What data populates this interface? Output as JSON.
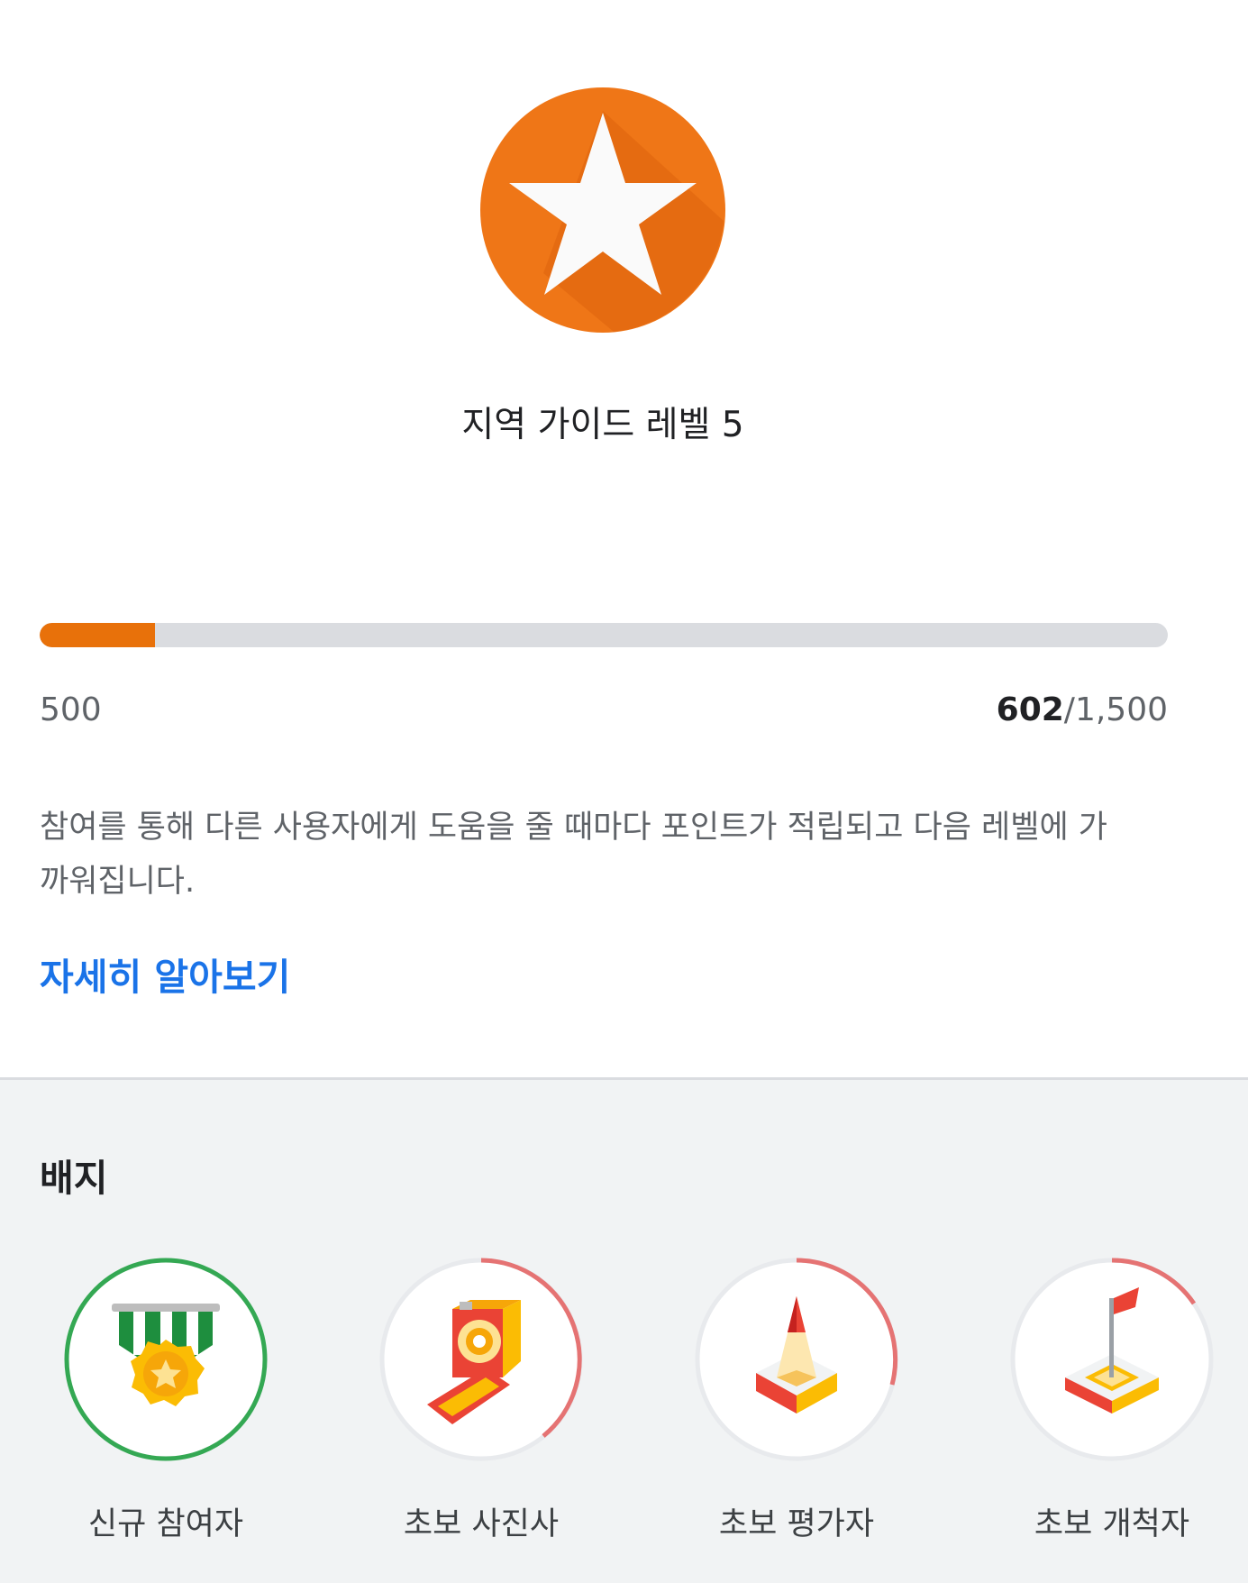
{
  "level": {
    "title": "지역 가이드 레벨 5",
    "icon": "star-icon",
    "color": "#e8710a",
    "progress_min": "500",
    "current_points": "602",
    "points_separator": "/",
    "target_points": "1,500",
    "progress_fraction": 0.102,
    "description": "참여를 통해 다른 사용자에게 도움을 줄 때마다 포인트가 적립되고 다음 레벨에 가까워집니다.",
    "learn_more": "자세히 알아보기"
  },
  "badges": {
    "title": "배지",
    "items": [
      {
        "label": "신규 참여자",
        "icon": "medal-icon"
      },
      {
        "label": "초보 사진사",
        "icon": "camera-icon"
      },
      {
        "label": "초보 평가자",
        "icon": "pencil-icon"
      },
      {
        "label": "초보 개척자",
        "icon": "flag-icon"
      }
    ]
  }
}
